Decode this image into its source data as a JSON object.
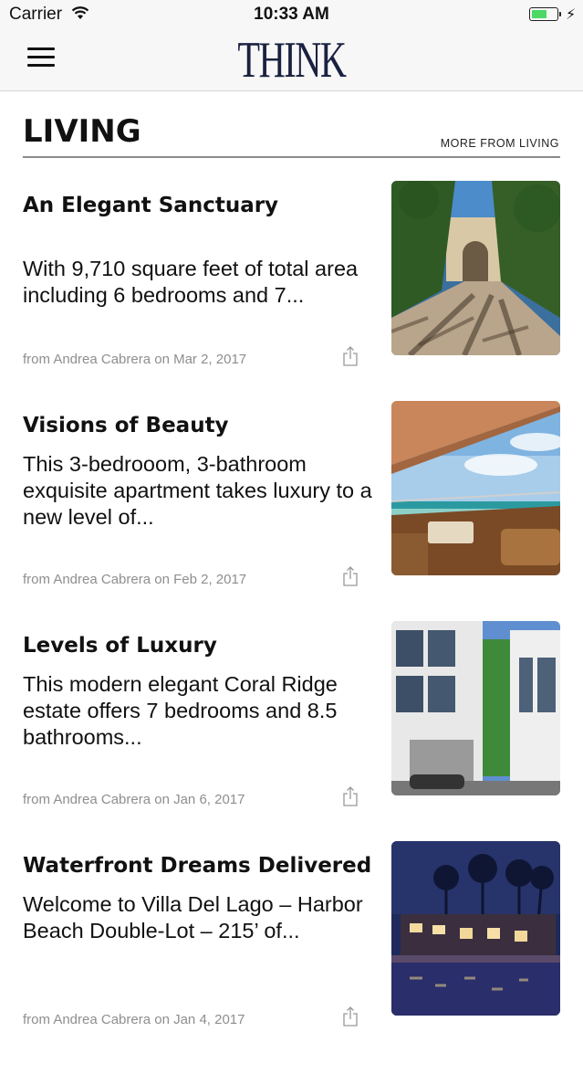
{
  "status_bar": {
    "carrier": "Carrier",
    "time": "10:33 AM",
    "battery_level": 0.62,
    "battery_color": "#4cd964",
    "icons": [
      "wifi-icon",
      "battery-icon",
      "charging-bolt-icon"
    ]
  },
  "nav": {
    "brand": "THINK",
    "menu_icon": "hamburger-menu-icon",
    "brand_color": "#1b2140"
  },
  "section": {
    "title": "LIVING",
    "more_link": "MORE FROM LIVING"
  },
  "articles": [
    {
      "title": "An Elegant Sanctuary",
      "summary": "With 9,710 square feet of total area including 6 bedrooms and 7...",
      "meta": "from Andrea Cabrera on Mar 2, 2017",
      "image": "palm-driveway-villa-photo"
    },
    {
      "title": "Visions of Beauty",
      "summary": "This 3-bedrooom, 3-bathroom exquisite apartment takes luxury to a new level of...",
      "meta": "from Andrea Cabrera on Feb 2, 2017",
      "image": "ocean-view-balcony-photo"
    },
    {
      "title": "Levels of Luxury",
      "summary": "This modern elegant Coral Ridge estate offers 7 bedrooms and 8.5 bathrooms...",
      "meta": "from Andrea Cabrera on Jan 6, 2017",
      "image": "modern-white-house-photo"
    },
    {
      "title": "Waterfront Dreams Delivered",
      "summary": "Welcome to Villa Del Lago – Harbor Beach Double-Lot – 215’ of...",
      "meta": "from Andrea Cabrera on Jan 4, 2017",
      "image": "waterfront-night-mansion-photo"
    }
  ]
}
